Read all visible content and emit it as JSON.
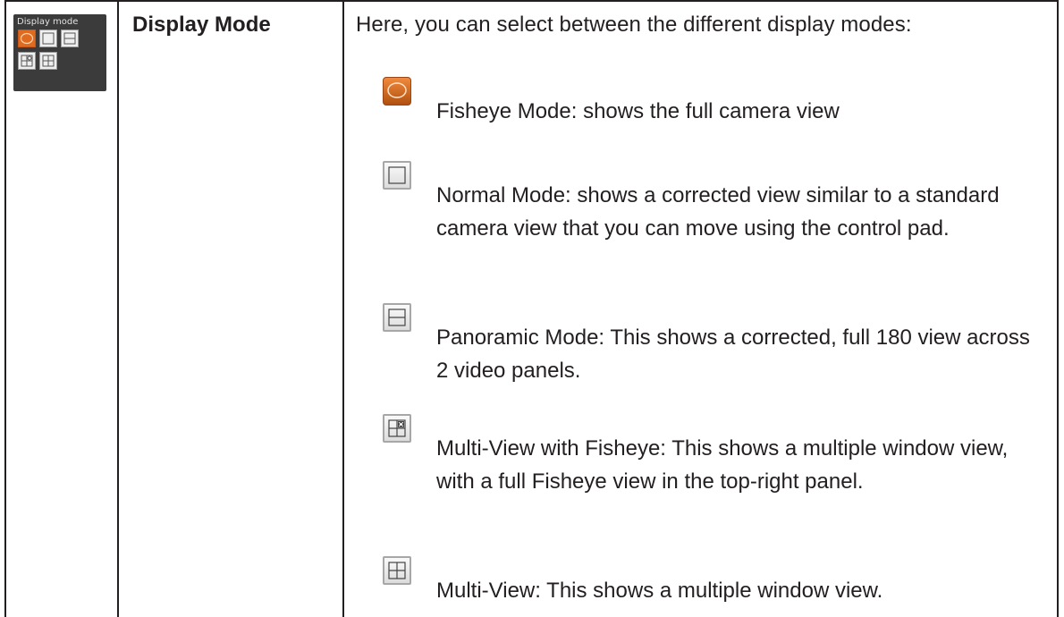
{
  "thumbnail": {
    "title": "Display mode"
  },
  "heading": "Display Mode",
  "intro": "Here, you can select between the different display modes:",
  "modes": [
    {
      "icon": "fisheye-icon",
      "text": "Fisheye Mode: shows the full camera view"
    },
    {
      "icon": "normal-view-icon",
      "text": "Normal Mode: shows a corrected view similar to a standard camera view that you can move using the control pad."
    },
    {
      "icon": "panoramic-view-icon",
      "text": "Panoramic Mode: This shows a corrected, full 180 view across 2 video panels."
    },
    {
      "icon": "multi-view-fisheye-icon",
      "text": "Multi-View with Fisheye: This shows a multiple window view, with a full Fisheye view in the top-right panel."
    },
    {
      "icon": "multi-view-icon",
      "text": "Multi-View: This shows a multiple window view."
    }
  ],
  "colors": {
    "accent_orange": "#e06a1e",
    "panel_dark": "#3b3b3b",
    "border": "#231f20"
  }
}
